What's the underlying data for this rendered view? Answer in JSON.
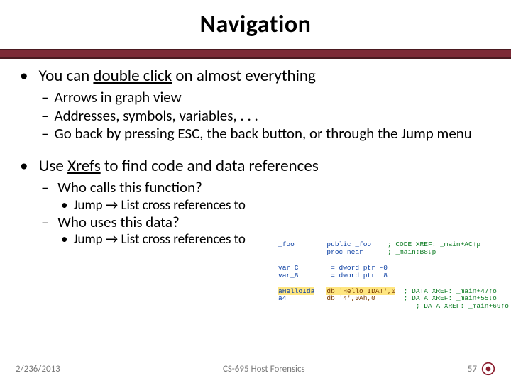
{
  "title": "Navigation",
  "bullets": {
    "b1": "You can ",
    "b1_emph": "double click",
    "b1_tail": " on almost everything",
    "b1_s1": "Arrows in graph view",
    "b1_s2": "Addresses, symbols, variables, . . .",
    "b1_s3": "Go back by pressing ESC, the back button, or through the Jump menu",
    "b2": "Use ",
    "b2_emph": "Xrefs",
    "b2_tail": " to find code and data references",
    "b2_s1": "Who calls this function?",
    "b2_s1_j": "Jump → List cross references to",
    "b2_s2": "Who uses this data?",
    "b2_s2_j": "Jump → List cross references to"
  },
  "code": {
    "l1a": "_foo",
    "l1b": "public _foo",
    "l1c": "; CODE XREF: _main+AC↑p",
    "l2b": "proc near",
    "l2c": "; _main:B8↓p",
    "l3a": "var_C",
    "l3b": "= dword ptr -0",
    "l4a": "var_8",
    "l4b": "= dword ptr  8",
    "l5a": "aHelloIda",
    "l5b": "db 'Hello IDA!',0",
    "l5c": "; DATA XREF: _main+47↑o",
    "l6a": "a4",
    "l6b": "db '4',0Ah,0",
    "l6c": "; DATA XREF: _main+55↓o",
    "l7c": "; DATA XREF: _main+69↑o"
  },
  "footer": {
    "date": "2/236/2013",
    "course": "CS-695 Host Forensics",
    "page": "57"
  }
}
